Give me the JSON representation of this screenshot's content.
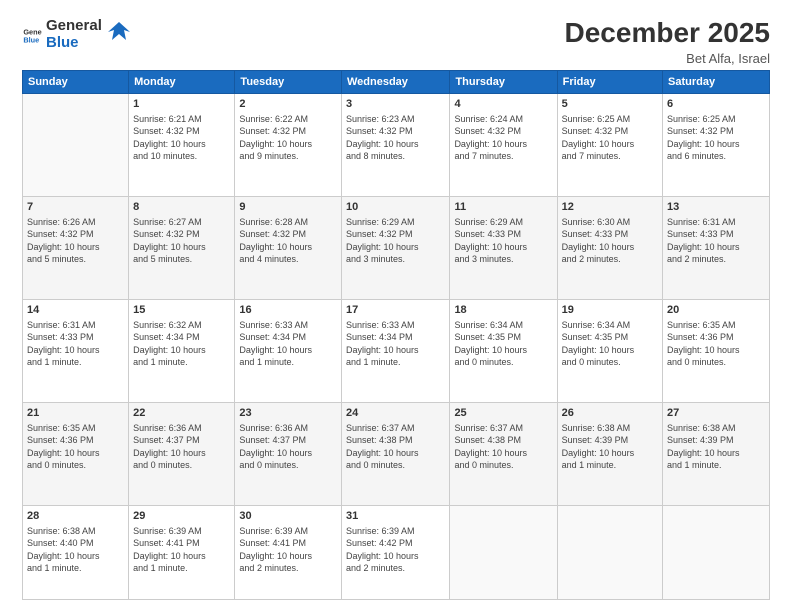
{
  "header": {
    "logo_general": "General",
    "logo_blue": "Blue",
    "month_year": "December 2025",
    "location": "Bet Alfa, Israel"
  },
  "weekdays": [
    "Sunday",
    "Monday",
    "Tuesday",
    "Wednesday",
    "Thursday",
    "Friday",
    "Saturday"
  ],
  "weeks": [
    [
      {
        "day": "",
        "info": ""
      },
      {
        "day": "1",
        "info": "Sunrise: 6:21 AM\nSunset: 4:32 PM\nDaylight: 10 hours\nand 10 minutes."
      },
      {
        "day": "2",
        "info": "Sunrise: 6:22 AM\nSunset: 4:32 PM\nDaylight: 10 hours\nand 9 minutes."
      },
      {
        "day": "3",
        "info": "Sunrise: 6:23 AM\nSunset: 4:32 PM\nDaylight: 10 hours\nand 8 minutes."
      },
      {
        "day": "4",
        "info": "Sunrise: 6:24 AM\nSunset: 4:32 PM\nDaylight: 10 hours\nand 7 minutes."
      },
      {
        "day": "5",
        "info": "Sunrise: 6:25 AM\nSunset: 4:32 PM\nDaylight: 10 hours\nand 7 minutes."
      },
      {
        "day": "6",
        "info": "Sunrise: 6:25 AM\nSunset: 4:32 PM\nDaylight: 10 hours\nand 6 minutes."
      }
    ],
    [
      {
        "day": "7",
        "info": "Sunrise: 6:26 AM\nSunset: 4:32 PM\nDaylight: 10 hours\nand 5 minutes."
      },
      {
        "day": "8",
        "info": "Sunrise: 6:27 AM\nSunset: 4:32 PM\nDaylight: 10 hours\nand 5 minutes."
      },
      {
        "day": "9",
        "info": "Sunrise: 6:28 AM\nSunset: 4:32 PM\nDaylight: 10 hours\nand 4 minutes."
      },
      {
        "day": "10",
        "info": "Sunrise: 6:29 AM\nSunset: 4:32 PM\nDaylight: 10 hours\nand 3 minutes."
      },
      {
        "day": "11",
        "info": "Sunrise: 6:29 AM\nSunset: 4:33 PM\nDaylight: 10 hours\nand 3 minutes."
      },
      {
        "day": "12",
        "info": "Sunrise: 6:30 AM\nSunset: 4:33 PM\nDaylight: 10 hours\nand 2 minutes."
      },
      {
        "day": "13",
        "info": "Sunrise: 6:31 AM\nSunset: 4:33 PM\nDaylight: 10 hours\nand 2 minutes."
      }
    ],
    [
      {
        "day": "14",
        "info": "Sunrise: 6:31 AM\nSunset: 4:33 PM\nDaylight: 10 hours\nand 1 minute."
      },
      {
        "day": "15",
        "info": "Sunrise: 6:32 AM\nSunset: 4:34 PM\nDaylight: 10 hours\nand 1 minute."
      },
      {
        "day": "16",
        "info": "Sunrise: 6:33 AM\nSunset: 4:34 PM\nDaylight: 10 hours\nand 1 minute."
      },
      {
        "day": "17",
        "info": "Sunrise: 6:33 AM\nSunset: 4:34 PM\nDaylight: 10 hours\nand 1 minute."
      },
      {
        "day": "18",
        "info": "Sunrise: 6:34 AM\nSunset: 4:35 PM\nDaylight: 10 hours\nand 0 minutes."
      },
      {
        "day": "19",
        "info": "Sunrise: 6:34 AM\nSunset: 4:35 PM\nDaylight: 10 hours\nand 0 minutes."
      },
      {
        "day": "20",
        "info": "Sunrise: 6:35 AM\nSunset: 4:36 PM\nDaylight: 10 hours\nand 0 minutes."
      }
    ],
    [
      {
        "day": "21",
        "info": "Sunrise: 6:35 AM\nSunset: 4:36 PM\nDaylight: 10 hours\nand 0 minutes."
      },
      {
        "day": "22",
        "info": "Sunrise: 6:36 AM\nSunset: 4:37 PM\nDaylight: 10 hours\nand 0 minutes."
      },
      {
        "day": "23",
        "info": "Sunrise: 6:36 AM\nSunset: 4:37 PM\nDaylight: 10 hours\nand 0 minutes."
      },
      {
        "day": "24",
        "info": "Sunrise: 6:37 AM\nSunset: 4:38 PM\nDaylight: 10 hours\nand 0 minutes."
      },
      {
        "day": "25",
        "info": "Sunrise: 6:37 AM\nSunset: 4:38 PM\nDaylight: 10 hours\nand 0 minutes."
      },
      {
        "day": "26",
        "info": "Sunrise: 6:38 AM\nSunset: 4:39 PM\nDaylight: 10 hours\nand 1 minute."
      },
      {
        "day": "27",
        "info": "Sunrise: 6:38 AM\nSunset: 4:39 PM\nDaylight: 10 hours\nand 1 minute."
      }
    ],
    [
      {
        "day": "28",
        "info": "Sunrise: 6:38 AM\nSunset: 4:40 PM\nDaylight: 10 hours\nand 1 minute."
      },
      {
        "day": "29",
        "info": "Sunrise: 6:39 AM\nSunset: 4:41 PM\nDaylight: 10 hours\nand 1 minute."
      },
      {
        "day": "30",
        "info": "Sunrise: 6:39 AM\nSunset: 4:41 PM\nDaylight: 10 hours\nand 2 minutes."
      },
      {
        "day": "31",
        "info": "Sunrise: 6:39 AM\nSunset: 4:42 PM\nDaylight: 10 hours\nand 2 minutes."
      },
      {
        "day": "",
        "info": ""
      },
      {
        "day": "",
        "info": ""
      },
      {
        "day": "",
        "info": ""
      }
    ]
  ]
}
